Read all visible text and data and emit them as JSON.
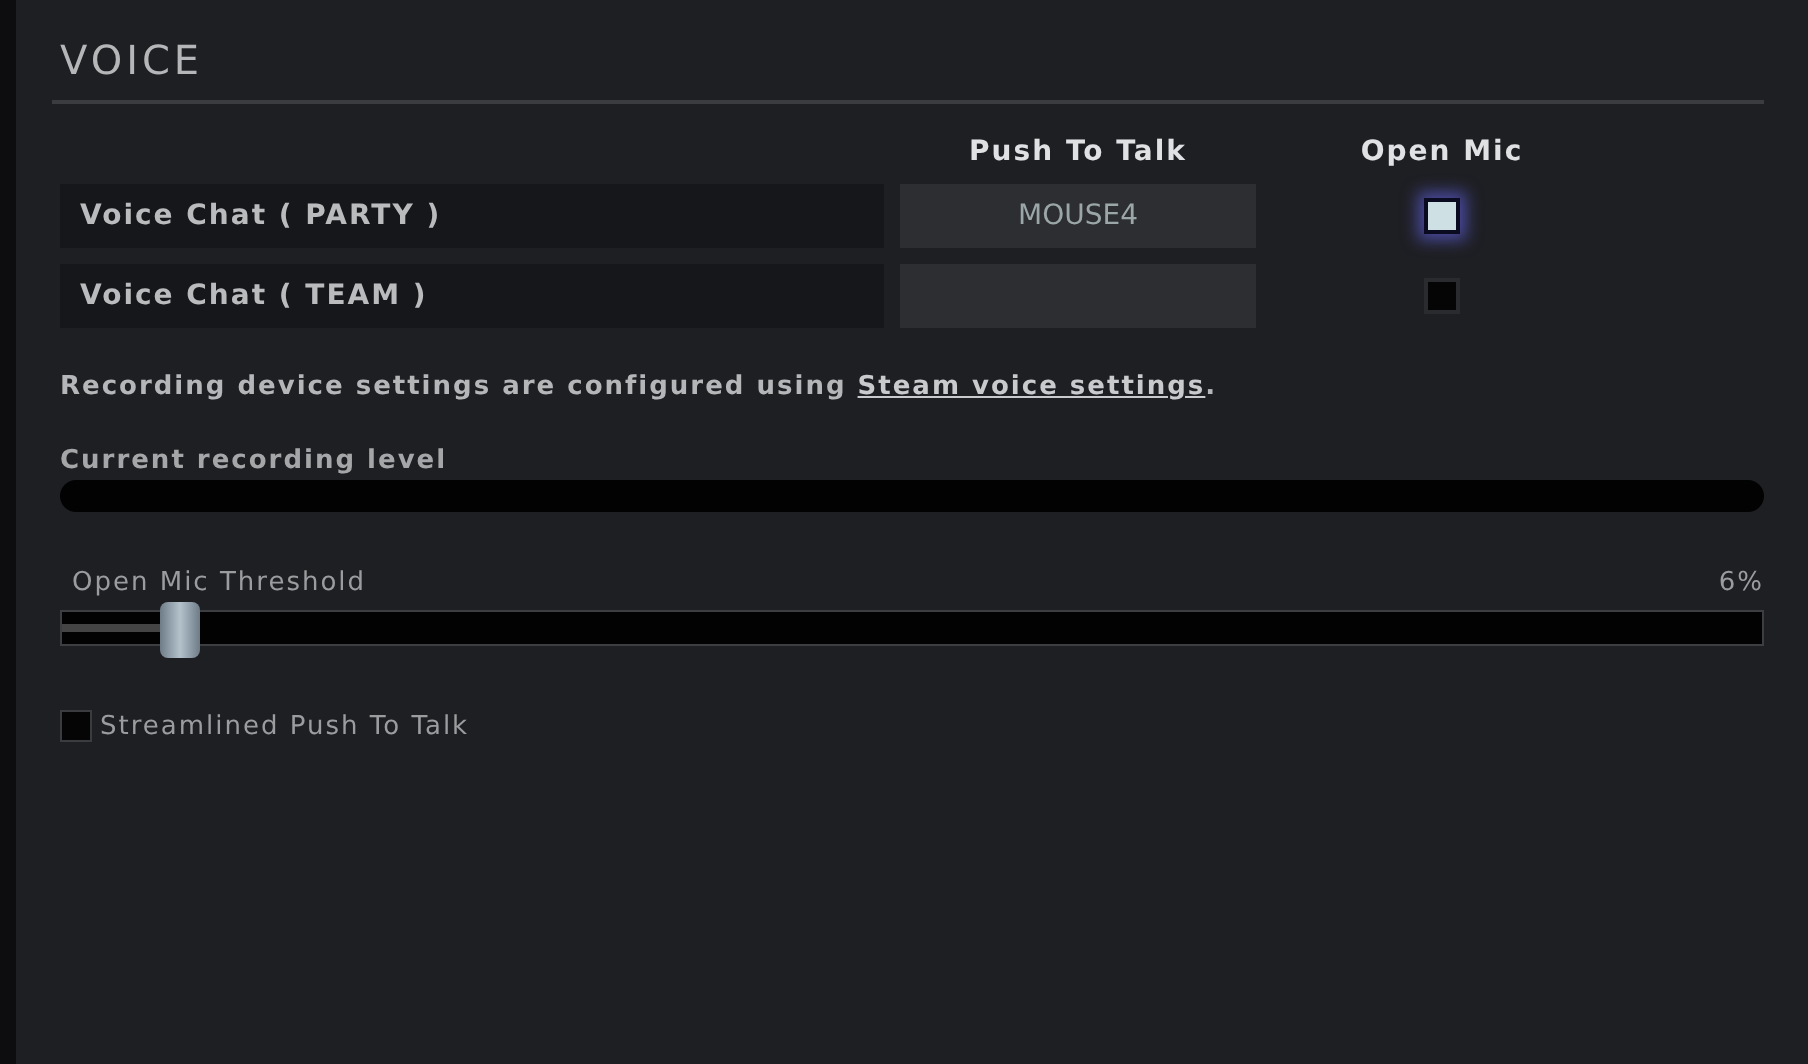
{
  "section": {
    "title": "VOICE"
  },
  "columns": {
    "push_to_talk": "Push To Talk",
    "open_mic": "Open Mic"
  },
  "rows": [
    {
      "label": "Voice Chat ( PARTY )",
      "key": "MOUSE4",
      "open_mic": true
    },
    {
      "label": "Voice Chat ( TEAM )",
      "open_mic": false
    }
  ],
  "note": {
    "text": "Recording device settings are configured using ",
    "link": "Steam voice settings",
    "after": "."
  },
  "recording": {
    "label": "Current recording level"
  },
  "threshold": {
    "label": "Open Mic Threshold",
    "reading": "6%",
    "level": 0.07
  },
  "streamlined": {
    "label": "Streamlined Push To Talk",
    "checked": false
  }
}
